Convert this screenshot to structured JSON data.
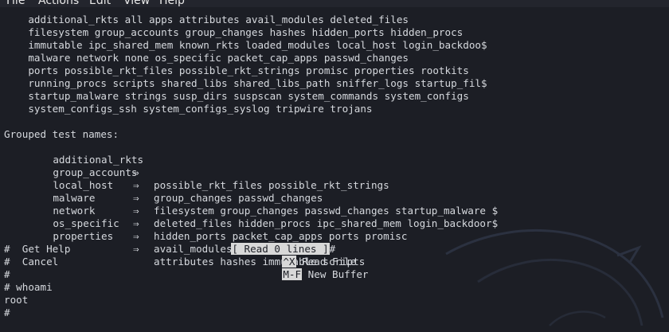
{
  "menu": {
    "items": [
      "File",
      "Actions",
      "Edit",
      "View",
      "Help"
    ]
  },
  "terminal": {
    "test_names": [
      "    additional_rkts all apps attributes avail_modules deleted_files",
      "    filesystem group_accounts group_changes hashes hidden_ports hidden_procs",
      "    immutable ipc_shared_mem known_rkts loaded_modules local_host login_backdoo$",
      "    malware network none os_specific packet_cap_apps passwd_changes",
      "    ports possible_rkt_files possible_rkt_strings promisc properties rootkits",
      "    running_procs scripts shared_libs shared_libs_path sniffer_logs startup_fil$",
      "    startup_malware strings susp_dirs suspscan system_commands system_configs",
      "    system_configs_ssh system_configs_syslog tripwire trojans"
    ],
    "grouped_header": "Grouped test names:",
    "groups": [
      {
        "name": "additional_rkts",
        "arrow": "⇒",
        "tests": "possible_rkt_files possible_rkt_strings"
      },
      {
        "name": "group_accounts",
        "arrow": "⇒",
        "tests": "group_changes passwd_changes"
      },
      {
        "name": "local_host",
        "arrow": "⇒",
        "tests": "filesystem group_changes passwd_changes startup_malware $"
      },
      {
        "name": "malware",
        "arrow": "⇒",
        "tests": "deleted_files hidden_procs ipc_shared_mem login_backdoor$"
      },
      {
        "name": "network",
        "arrow": "⇒",
        "tests": "hidden_ports packet_cap_apps ports promisc"
      },
      {
        "name": "os_specific",
        "arrow": "⇒",
        "tests": "avail_modules loaded_modules"
      },
      {
        "name": "properties",
        "arrow": "⇒",
        "tests": "attributes hashes immutable scripts"
      }
    ],
    "status_message": "[ Read 0 lines ]",
    "status_suffix": "#",
    "shortcuts": [
      {
        "prefix": "#  Get Help",
        "key": "^X",
        "label": " Read File"
      },
      {
        "prefix": "#  Cancel",
        "key": "M-F",
        "label": " New Buffer"
      }
    ],
    "tail_lines": [
      "#",
      "# whoami",
      "root",
      "#"
    ]
  }
}
